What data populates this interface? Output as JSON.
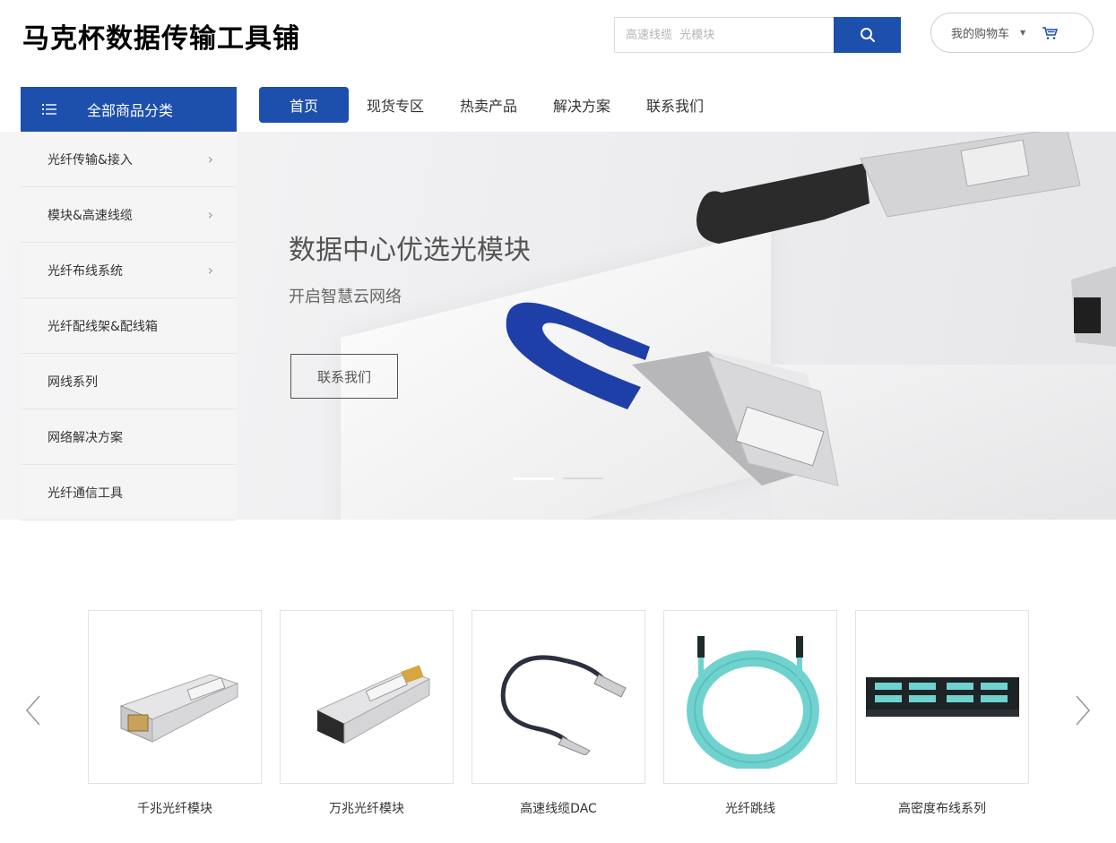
{
  "header": {
    "shop_title": "马克杯数据传输工具铺",
    "search_placeholder": "高速线缆  光模块",
    "cart_label": "我的购物车"
  },
  "category_menu": {
    "title": "全部商品分类",
    "items": [
      {
        "label": "光纤传输&接入",
        "has_submenu": true
      },
      {
        "label": "模块&高速线缆",
        "has_submenu": true
      },
      {
        "label": "光纤布线系统",
        "has_submenu": true
      },
      {
        "label": "光纤配线架&配线箱",
        "has_submenu": false
      },
      {
        "label": "网线系列",
        "has_submenu": false
      },
      {
        "label": "网络解决方案",
        "has_submenu": false
      },
      {
        "label": "光纤通信工具",
        "has_submenu": false
      }
    ]
  },
  "nav": {
    "items": [
      {
        "label": "首页",
        "active": true
      },
      {
        "label": "现货专区",
        "active": false
      },
      {
        "label": "热卖产品",
        "active": false
      },
      {
        "label": "解决方案",
        "active": false
      },
      {
        "label": "联系我们",
        "active": false
      }
    ]
  },
  "hero": {
    "title": "数据中心优选光模块",
    "subtitle": "开启智慧云网络",
    "button_label": "联系我们",
    "slide_count": 2,
    "active_slide": 1
  },
  "products": [
    {
      "name": "千兆光纤模块",
      "icon": "copper-sfp-module-icon"
    },
    {
      "name": "万兆光纤模块",
      "icon": "optical-sfp-module-icon"
    },
    {
      "name": "高速线缆DAC",
      "icon": "dac-cable-icon"
    },
    {
      "name": "光纤跳线",
      "icon": "fiber-patch-cord-icon"
    },
    {
      "name": "高密度布线系列",
      "icon": "patch-panel-icon"
    }
  ],
  "colors": {
    "brand_blue": "#1d4fad",
    "sidebar_bg": "#f5f5f5",
    "aqua_fiber": "#6fd2cf"
  }
}
